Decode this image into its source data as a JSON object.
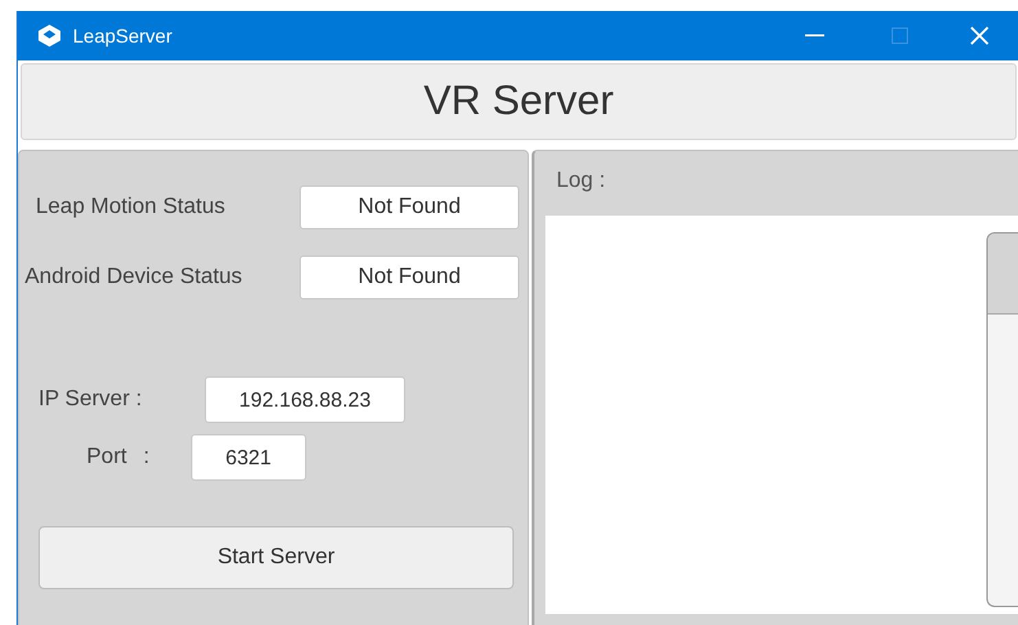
{
  "window": {
    "title": "LeapServer"
  },
  "header": {
    "title": "VR Server"
  },
  "status": [
    {
      "label": "Leap Motion Status",
      "value": "Not Found"
    },
    {
      "label": "Android Device Status",
      "value": "Not Found"
    }
  ],
  "connection": {
    "ip_label": "IP Server :",
    "ip_value": "192.168.88.23",
    "port_label": "Port",
    "port_colon": ":",
    "port_value": "6321"
  },
  "start_button": {
    "label": "Start Server"
  },
  "log": {
    "label": "Log :"
  }
}
